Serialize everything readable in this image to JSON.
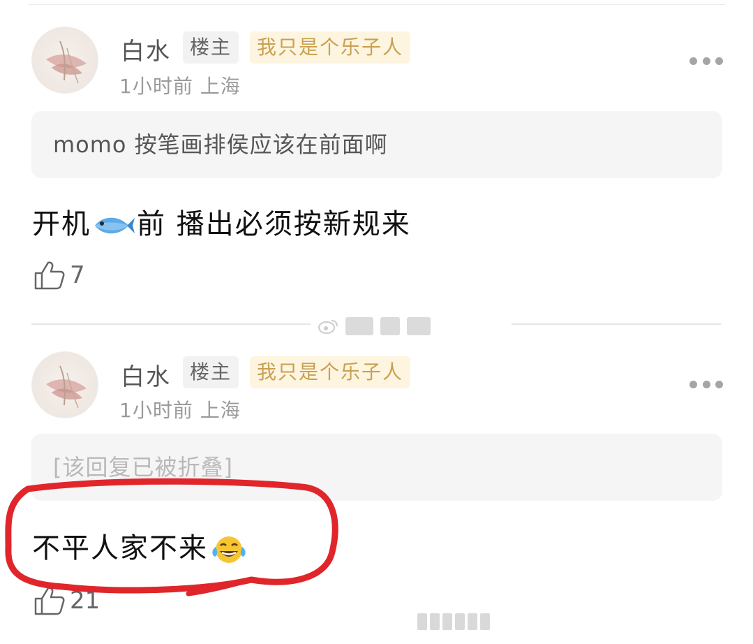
{
  "comments": [
    {
      "username": "白水",
      "op_badge": "楼主",
      "user_tag": "我只是个乐子人",
      "time": "1小时前",
      "location": "上海",
      "quoted_reply": "momo 按笔画排侯应该在前面啊",
      "text_before_emoji": "开机",
      "emoji": "fish-emoji",
      "text_after_emoji": "前  播出必须按新规来",
      "likes": "7"
    },
    {
      "username": "白水",
      "op_badge": "楼主",
      "user_tag": "我只是个乐子人",
      "time": "1小时前",
      "location": "上海",
      "quoted_reply": "[该回复已被折叠]",
      "text": "不平人家不来",
      "emoji": "tears-of-joy-emoji",
      "likes": "21"
    }
  ],
  "annotation_color": "#e0262b"
}
